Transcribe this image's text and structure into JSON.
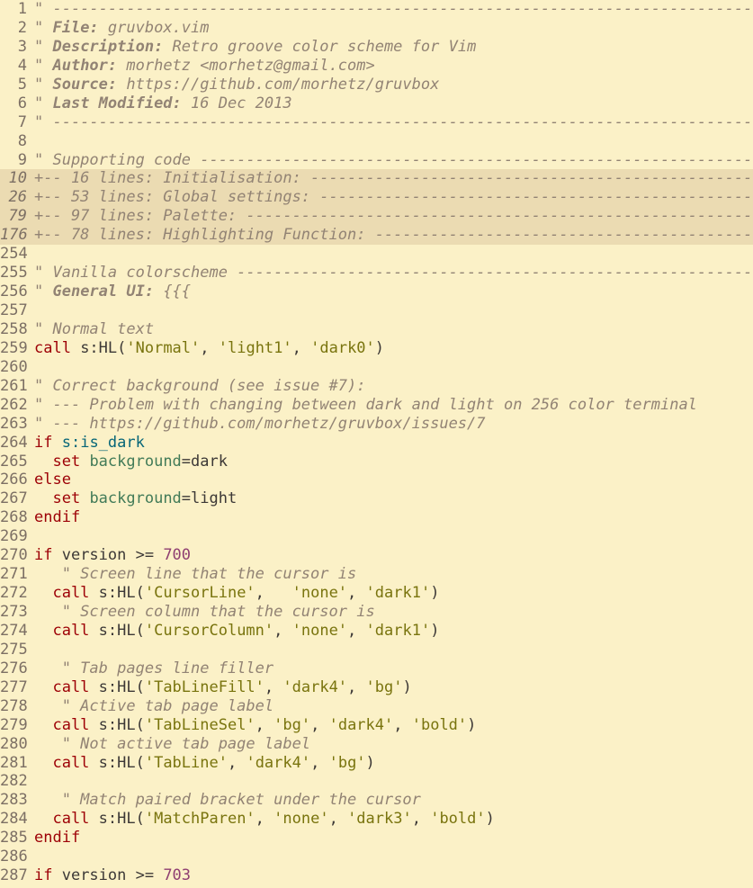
{
  "editor": {
    "lines": [
      {
        "num": "1",
        "tokens": [
          {
            "t": "\" -----------------------------------------------------------------------------",
            "c": "comment"
          }
        ]
      },
      {
        "num": "2",
        "tokens": [
          {
            "t": "\" ",
            "c": "comment"
          },
          {
            "t": "File:",
            "c": "commentbold"
          },
          {
            "t": " gruvbox.vim",
            "c": "comment"
          }
        ]
      },
      {
        "num": "3",
        "tokens": [
          {
            "t": "\" ",
            "c": "comment"
          },
          {
            "t": "Description:",
            "c": "commentbold"
          },
          {
            "t": " Retro groove color scheme for Vim",
            "c": "comment"
          }
        ]
      },
      {
        "num": "4",
        "tokens": [
          {
            "t": "\" ",
            "c": "comment"
          },
          {
            "t": "Author:",
            "c": "commentbold"
          },
          {
            "t": " morhetz <morhetz@gmail.com>",
            "c": "comment"
          }
        ]
      },
      {
        "num": "5",
        "tokens": [
          {
            "t": "\" ",
            "c": "comment"
          },
          {
            "t": "Source:",
            "c": "commentbold"
          },
          {
            "t": " https://github.com/morhetz/gruvbox",
            "c": "comment"
          }
        ]
      },
      {
        "num": "6",
        "tokens": [
          {
            "t": "\" ",
            "c": "comment"
          },
          {
            "t": "Last Modified:",
            "c": "commentbold"
          },
          {
            "t": " 16 Dec 2013",
            "c": "comment"
          }
        ]
      },
      {
        "num": "7",
        "tokens": [
          {
            "t": "\" -----------------------------------------------------------------------------",
            "c": "comment"
          }
        ]
      },
      {
        "num": "8",
        "tokens": []
      },
      {
        "num": "9",
        "tokens": [
          {
            "t": "\" Supporting code -------------------------------------------------------------",
            "c": "comment"
          }
        ]
      },
      {
        "num": "10",
        "folded": true,
        "tokens": [
          {
            "t": "+-- 16 lines: Initialisation: -----------------------------------------------------",
            "c": "fold"
          }
        ]
      },
      {
        "num": "26",
        "folded": true,
        "tokens": [
          {
            "t": "+-- 53 lines: Global settings: ----------------------------------------------------",
            "c": "fold"
          }
        ]
      },
      {
        "num": "79",
        "folded": true,
        "tokens": [
          {
            "t": "+-- 97 lines: Palette: ------------------------------------------------------------",
            "c": "fold"
          }
        ]
      },
      {
        "num": "176",
        "folded": true,
        "tokens": [
          {
            "t": "+-- 78 lines: Highlighting Function: ----------------------------------------------",
            "c": "fold"
          }
        ]
      },
      {
        "num": "254",
        "tokens": []
      },
      {
        "num": "255",
        "tokens": [
          {
            "t": "\" Vanilla colorscheme ---------------------------------------------------------",
            "c": "comment"
          }
        ]
      },
      {
        "num": "256",
        "tokens": [
          {
            "t": "\" ",
            "c": "comment"
          },
          {
            "t": "General UI:",
            "c": "commentbold"
          },
          {
            "t": " {{{",
            "c": "comment"
          }
        ]
      },
      {
        "num": "257",
        "tokens": []
      },
      {
        "num": "258",
        "tokens": [
          {
            "t": "\" Normal text",
            "c": "comment"
          }
        ]
      },
      {
        "num": "259",
        "tokens": [
          {
            "t": "call",
            "c": "keyword"
          },
          {
            "t": " s:HL(",
            "c": "plain"
          },
          {
            "t": "'Normal'",
            "c": "string"
          },
          {
            "t": ", ",
            "c": "plain"
          },
          {
            "t": "'light1'",
            "c": "string"
          },
          {
            "t": ", ",
            "c": "plain"
          },
          {
            "t": "'dark0'",
            "c": "string"
          },
          {
            "t": ")",
            "c": "plain"
          }
        ]
      },
      {
        "num": "260",
        "tokens": []
      },
      {
        "num": "261",
        "tokens": [
          {
            "t": "\" Correct background (see issue #7):",
            "c": "comment"
          }
        ]
      },
      {
        "num": "262",
        "tokens": [
          {
            "t": "\" --- Problem with changing between dark and light on 256 color terminal",
            "c": "comment"
          }
        ]
      },
      {
        "num": "263",
        "tokens": [
          {
            "t": "\" --- https://github.com/morhetz/gruvbox/issues/7",
            "c": "comment"
          }
        ]
      },
      {
        "num": "264",
        "tokens": [
          {
            "t": "if",
            "c": "keyword"
          },
          {
            "t": " ",
            "c": "plain"
          },
          {
            "t": "s:is_dark",
            "c": "var"
          }
        ]
      },
      {
        "num": "265",
        "tokens": [
          {
            "t": "  set",
            "c": "keyword"
          },
          {
            "t": " ",
            "c": "plain"
          },
          {
            "t": "background",
            "c": "option"
          },
          {
            "t": "=dark",
            "c": "plain"
          }
        ]
      },
      {
        "num": "266",
        "tokens": [
          {
            "t": "else",
            "c": "keyword"
          }
        ]
      },
      {
        "num": "267",
        "tokens": [
          {
            "t": "  set",
            "c": "keyword"
          },
          {
            "t": " ",
            "c": "plain"
          },
          {
            "t": "background",
            "c": "option"
          },
          {
            "t": "=light",
            "c": "plain"
          }
        ]
      },
      {
        "num": "268",
        "tokens": [
          {
            "t": "endif",
            "c": "keyword"
          }
        ]
      },
      {
        "num": "269",
        "tokens": []
      },
      {
        "num": "270",
        "tokens": [
          {
            "t": "if",
            "c": "keyword"
          },
          {
            "t": " version >= ",
            "c": "plain"
          },
          {
            "t": "700",
            "c": "number"
          }
        ]
      },
      {
        "num": "271",
        "tokens": [
          {
            "t": "   \" Screen line that the cursor is",
            "c": "comment"
          }
        ]
      },
      {
        "num": "272",
        "tokens": [
          {
            "t": "  call",
            "c": "keyword"
          },
          {
            "t": " s:HL(",
            "c": "plain"
          },
          {
            "t": "'CursorLine'",
            "c": "string"
          },
          {
            "t": ",   ",
            "c": "plain"
          },
          {
            "t": "'none'",
            "c": "string"
          },
          {
            "t": ", ",
            "c": "plain"
          },
          {
            "t": "'dark1'",
            "c": "string"
          },
          {
            "t": ")",
            "c": "plain"
          }
        ]
      },
      {
        "num": "273",
        "tokens": [
          {
            "t": "   \" Screen column that the cursor is",
            "c": "comment"
          }
        ]
      },
      {
        "num": "274",
        "tokens": [
          {
            "t": "  call",
            "c": "keyword"
          },
          {
            "t": " s:HL(",
            "c": "plain"
          },
          {
            "t": "'CursorColumn'",
            "c": "string"
          },
          {
            "t": ", ",
            "c": "plain"
          },
          {
            "t": "'none'",
            "c": "string"
          },
          {
            "t": ", ",
            "c": "plain"
          },
          {
            "t": "'dark1'",
            "c": "string"
          },
          {
            "t": ")",
            "c": "plain"
          }
        ]
      },
      {
        "num": "275",
        "tokens": []
      },
      {
        "num": "276",
        "tokens": [
          {
            "t": "   \" Tab pages line filler",
            "c": "comment"
          }
        ]
      },
      {
        "num": "277",
        "tokens": [
          {
            "t": "  call",
            "c": "keyword"
          },
          {
            "t": " s:HL(",
            "c": "plain"
          },
          {
            "t": "'TabLineFill'",
            "c": "string"
          },
          {
            "t": ", ",
            "c": "plain"
          },
          {
            "t": "'dark4'",
            "c": "string"
          },
          {
            "t": ", ",
            "c": "plain"
          },
          {
            "t": "'bg'",
            "c": "string"
          },
          {
            "t": ")",
            "c": "plain"
          }
        ]
      },
      {
        "num": "278",
        "tokens": [
          {
            "t": "   \" Active tab page label",
            "c": "comment"
          }
        ]
      },
      {
        "num": "279",
        "tokens": [
          {
            "t": "  call",
            "c": "keyword"
          },
          {
            "t": " s:HL(",
            "c": "plain"
          },
          {
            "t": "'TabLineSel'",
            "c": "string"
          },
          {
            "t": ", ",
            "c": "plain"
          },
          {
            "t": "'bg'",
            "c": "string"
          },
          {
            "t": ", ",
            "c": "plain"
          },
          {
            "t": "'dark4'",
            "c": "string"
          },
          {
            "t": ", ",
            "c": "plain"
          },
          {
            "t": "'bold'",
            "c": "string"
          },
          {
            "t": ")",
            "c": "plain"
          }
        ]
      },
      {
        "num": "280",
        "tokens": [
          {
            "t": "   \" Not active tab page label",
            "c": "comment"
          }
        ]
      },
      {
        "num": "281",
        "tokens": [
          {
            "t": "  call",
            "c": "keyword"
          },
          {
            "t": " s:HL(",
            "c": "plain"
          },
          {
            "t": "'TabLine'",
            "c": "string"
          },
          {
            "t": ", ",
            "c": "plain"
          },
          {
            "t": "'dark4'",
            "c": "string"
          },
          {
            "t": ", ",
            "c": "plain"
          },
          {
            "t": "'bg'",
            "c": "string"
          },
          {
            "t": ")",
            "c": "plain"
          }
        ]
      },
      {
        "num": "282",
        "tokens": []
      },
      {
        "num": "283",
        "tokens": [
          {
            "t": "   \" Match paired bracket under the cursor",
            "c": "comment"
          }
        ]
      },
      {
        "num": "284",
        "tokens": [
          {
            "t": "  call",
            "c": "keyword"
          },
          {
            "t": " s:HL(",
            "c": "plain"
          },
          {
            "t": "'MatchParen'",
            "c": "string"
          },
          {
            "t": ", ",
            "c": "plain"
          },
          {
            "t": "'none'",
            "c": "string"
          },
          {
            "t": ", ",
            "c": "plain"
          },
          {
            "t": "'dark3'",
            "c": "string"
          },
          {
            "t": ", ",
            "c": "plain"
          },
          {
            "t": "'bold'",
            "c": "string"
          },
          {
            "t": ")",
            "c": "plain"
          }
        ]
      },
      {
        "num": "285",
        "tokens": [
          {
            "t": "endif",
            "c": "keyword"
          }
        ]
      },
      {
        "num": "286",
        "tokens": []
      },
      {
        "num": "287",
        "tokens": [
          {
            "t": "if",
            "c": "keyword"
          },
          {
            "t": " version >= ",
            "c": "plain"
          },
          {
            "t": "703",
            "c": "number"
          }
        ]
      }
    ]
  },
  "colors": {
    "background": "#fbf1c7",
    "fold_background": "#ebdbb2",
    "comment": "#928374",
    "keyword": "#9d0006",
    "string": "#79740e",
    "number": "#8f3f71",
    "variable": "#076678",
    "option": "#427b58",
    "text": "#3c3836",
    "line_number": "#7c6f64"
  }
}
